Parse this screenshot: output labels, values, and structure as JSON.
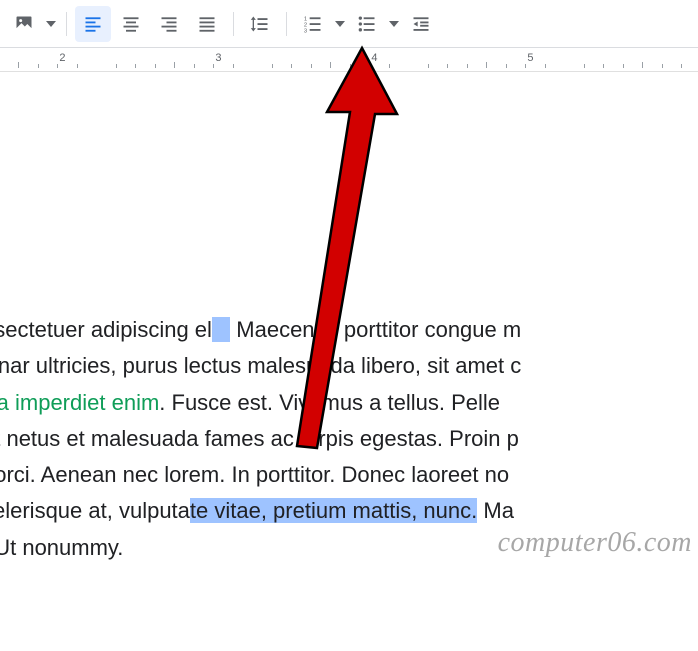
{
  "toolbar": {
    "image_btn": "image-icon",
    "align_left": "align-left-icon",
    "align_center": "align-center-icon",
    "align_right": "align-right-icon",
    "align_justify": "align-justify-icon",
    "line_spacing": "line-spacing-icon",
    "numbered_list": "numbered-list-icon",
    "bulleted_list": "bulleted-list-icon",
    "decrease_indent": "decrease-indent-icon"
  },
  "ruler": {
    "numbers": [
      "2",
      "3",
      "4",
      "5"
    ]
  },
  "document": {
    "line1_a": "nsectetuer adipiscing el",
    "line1_b": " Maecenas porttitor congue m",
    "line2": "vinar ultricies, purus lectus malesuada libero, sit amet c",
    "line3_link": "rra imperdiet enim",
    "line3_b": ". Fusce est. Vivamus a tellus. Pelle",
    "line4": "et netus et malesuada fames ac turpis egestas. Proin p",
    "line5": "t orci. Aenean nec lorem. In porttitor. Donec laoreet no",
    "line6_a": "celerisque at, vulputa",
    "line6_sel": "te vitae, pretium mattis, nunc.",
    "line6_b": " Ma",
    "line7": ". Ut nonummy."
  },
  "watermark": "computer06.com"
}
